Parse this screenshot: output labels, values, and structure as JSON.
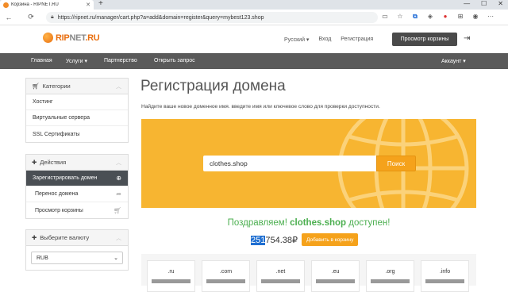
{
  "browser": {
    "tab_title": "Корзина - RIPNET.RU",
    "tab_close": "✕",
    "new_tab": "+",
    "url": "https://ripnet.ru/manager/cart.php?a=add&domain=register&query=mybest123.shop",
    "window_buttons": [
      "—",
      "☐",
      "✕"
    ],
    "nav_icons": [
      "←",
      "⟳"
    ]
  },
  "logo": {
    "rip": "RIP",
    "net": "NET",
    "ru": ".RU"
  },
  "top_links": {
    "language": "Русский ▾",
    "login": "Вход",
    "register": "Регистрация"
  },
  "cart_button": "Просмотр корзины",
  "navbar": {
    "home": "Главная",
    "services": "Услуги ▾",
    "partnership": "Партнерство",
    "ticket": "Открыть запрос",
    "account": "Аккаунт ▾"
  },
  "sidebar": {
    "categories": {
      "title": "Категории",
      "items": [
        "Хостинг",
        "Виртуальные сервера",
        "SSL Сертификаты"
      ]
    },
    "actions": {
      "title": "Действия",
      "items": [
        "Зарегистрировать домен",
        "Перенос домена",
        "Просмотр корзины"
      ]
    },
    "currency": {
      "title": "Выберите валюту",
      "selected": "RUB"
    }
  },
  "main": {
    "title": "Регистрация домена",
    "subtitle": "Найдите ваше новое доменное имя. введите имя или ключевое слово для проверки доступности.",
    "search_value": "clothes.shop",
    "search_button": "Поиск",
    "congrats_prefix": "Поздравляем!",
    "congrats_domain": "clothes.shop",
    "congrats_suffix": "доступен!",
    "price_highlight": "251",
    "price_rest": "754.38₽",
    "add_to_cart": "Добавить в корзину",
    "tlds": [
      ".ru",
      ".com",
      ".net",
      ".eu",
      ".org",
      ".info"
    ]
  },
  "colors": {
    "accent": "#f7b531",
    "button_orange": "#f5a21b",
    "navbar": "#5a5a5a",
    "success": "#4caf50"
  }
}
